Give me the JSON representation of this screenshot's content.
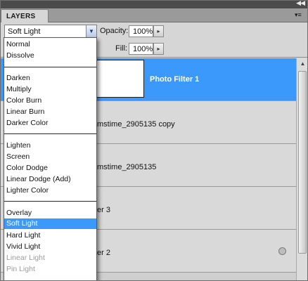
{
  "panel": {
    "tab_label": "LAYERS",
    "collapse_glyph": "◀◀",
    "menu_glyph": "▾≡"
  },
  "blend": {
    "current": "Soft Light",
    "arrow_glyph": "▼"
  },
  "opacity": {
    "label": "Opacity:",
    "value": "100%",
    "step_glyph": "▸"
  },
  "fill": {
    "label": "Fill:",
    "value": "100%",
    "step_glyph": "▸"
  },
  "layers": [
    {
      "name": "Photo Filter 1"
    },
    {
      "name": "mstime_2905135 copy"
    },
    {
      "name": "mstime_2905135"
    },
    {
      "name": "er 3"
    },
    {
      "name": "er 2"
    }
  ],
  "scrollbar": {
    "up_glyph": "▲"
  },
  "blend_modes": {
    "group1": [
      "Normal",
      "Dissolve"
    ],
    "group2": [
      "Darken",
      "Multiply",
      "Color Burn",
      "Linear Burn",
      "Darker Color"
    ],
    "group3": [
      "Lighten",
      "Screen",
      "Color Dodge",
      "Linear Dodge (Add)",
      "Lighter Color"
    ],
    "group4": [
      "Overlay",
      "Soft Light",
      "Hard Light",
      "Vivid Light",
      "Linear Light",
      "Pin Light"
    ]
  }
}
